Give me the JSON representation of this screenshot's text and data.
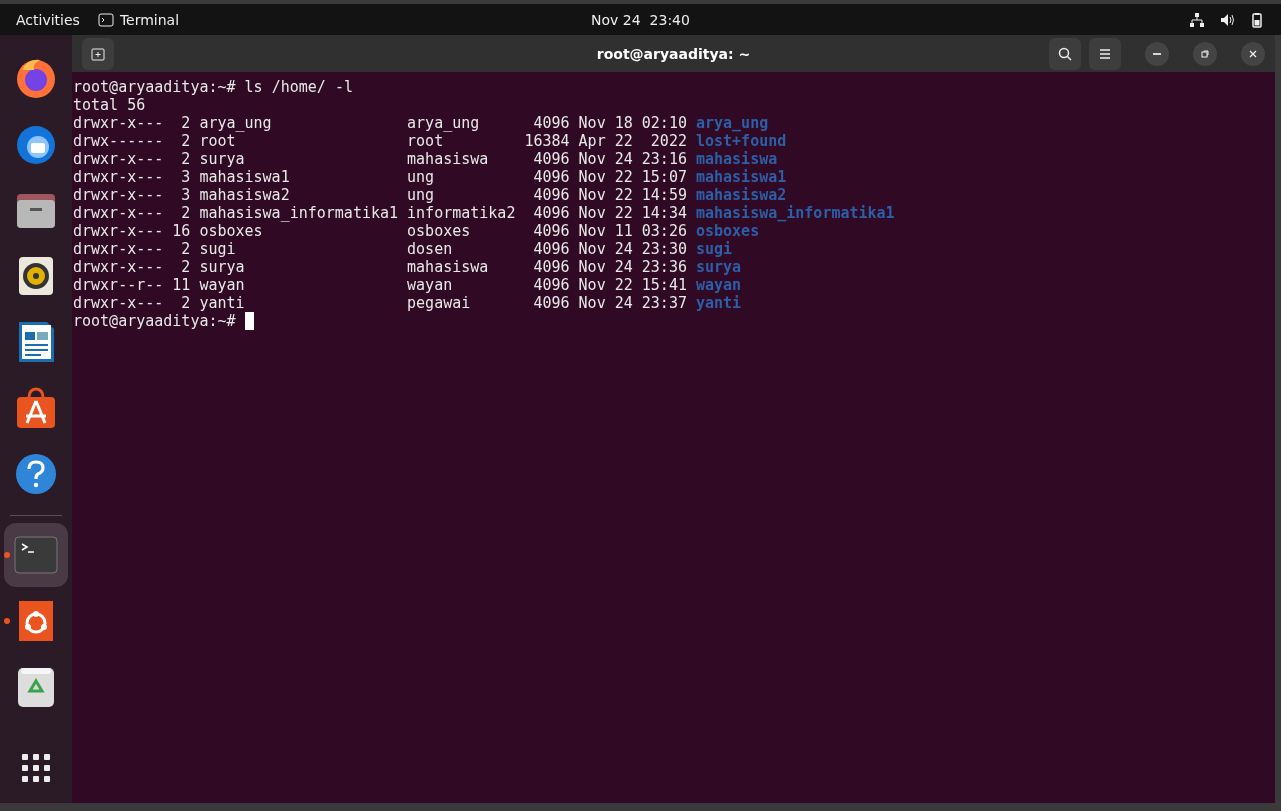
{
  "top_bar": {
    "activities": "Activities",
    "app_name": "Terminal",
    "clock": "Nov 24  23:40"
  },
  "dock": {
    "items": [
      {
        "kind": "browser",
        "running": false,
        "selected": false
      },
      {
        "kind": "mail",
        "running": false,
        "selected": false
      },
      {
        "kind": "files",
        "running": false,
        "selected": false
      },
      {
        "kind": "music",
        "running": false,
        "selected": false
      },
      {
        "kind": "writer",
        "running": false,
        "selected": false
      },
      {
        "kind": "store",
        "running": false,
        "selected": false
      },
      {
        "kind": "help",
        "running": false,
        "selected": false
      },
      {
        "kind": "terminal",
        "running": true,
        "selected": true
      },
      {
        "kind": "installer",
        "running": true,
        "selected": false
      },
      {
        "kind": "trash",
        "running": false,
        "selected": false
      },
      {
        "kind": "apps",
        "running": false,
        "selected": false
      }
    ]
  },
  "window": {
    "title": "root@aryaaditya: ~"
  },
  "terminal": {
    "command_prompt": "root@aryaaditya:~#",
    "command": "ls /home/ -l",
    "total": "total 56",
    "rows": [
      {
        "perms": "drwxr-x---",
        "links": "2",
        "owner": "arya_ung",
        "group": "arya_ung",
        "size": "4096",
        "date": "Nov 18 02:10",
        "name": "arya_ung"
      },
      {
        "perms": "drwx------",
        "links": "2",
        "owner": "root",
        "group": "root",
        "size": "16384",
        "date": "Apr 22  2022",
        "name": "lost+found"
      },
      {
        "perms": "drwxr-x---",
        "links": "2",
        "owner": "surya",
        "group": "mahasiswa",
        "size": "4096",
        "date": "Nov 24 23:16",
        "name": "mahasiswa"
      },
      {
        "perms": "drwxr-x---",
        "links": "3",
        "owner": "mahasiswa1",
        "group": "ung",
        "size": "4096",
        "date": "Nov 22 15:07",
        "name": "mahasiswa1"
      },
      {
        "perms": "drwxr-x---",
        "links": "3",
        "owner": "mahasiswa2",
        "group": "ung",
        "size": "4096",
        "date": "Nov 22 14:59",
        "name": "mahasiswa2"
      },
      {
        "perms": "drwxr-x---",
        "links": "2",
        "owner": "mahasiswa_informatika1",
        "group": "informatika2",
        "size": "4096",
        "date": "Nov 22 14:34",
        "name": "mahasiswa_informatika1"
      },
      {
        "perms": "drwxr-x---",
        "links": "16",
        "owner": "osboxes",
        "group": "osboxes",
        "size": "4096",
        "date": "Nov 11 03:26",
        "name": "osboxes"
      },
      {
        "perms": "drwxr-x---",
        "links": "2",
        "owner": "sugi",
        "group": "dosen",
        "size": "4096",
        "date": "Nov 24 23:30",
        "name": "sugi"
      },
      {
        "perms": "drwxr-x---",
        "links": "2",
        "owner": "surya",
        "group": "mahasiswa",
        "size": "4096",
        "date": "Nov 24 23:36",
        "name": "surya"
      },
      {
        "perms": "drwxr--r--",
        "links": "11",
        "owner": "wayan",
        "group": "wayan",
        "size": "4096",
        "date": "Nov 22 15:41",
        "name": "wayan"
      },
      {
        "perms": "drwxr-x---",
        "links": "2",
        "owner": "yanti",
        "group": "pegawai",
        "size": "4096",
        "date": "Nov 24 23:37",
        "name": "yanti"
      }
    ],
    "final_prompt": "root@aryaaditya:~#"
  }
}
